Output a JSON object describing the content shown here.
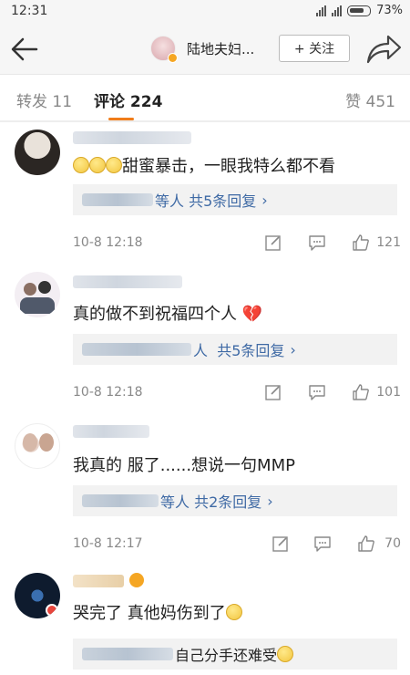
{
  "status": {
    "time": "12:31",
    "battery": "73%"
  },
  "header": {
    "account_name": "陆地夫妇...",
    "follow_label": "+ 关注"
  },
  "tabs": {
    "repost": "转发 11",
    "comments": "评论 224",
    "likes": "赞 451"
  },
  "comments": [
    {
      "text": "甜蜜暴击，一眼我特么都不看",
      "reply_suffix": "等人",
      "reply_count": "共5条回复",
      "time": "10-8 12:18",
      "likes": "121"
    },
    {
      "text": "真的做不到祝福四个人",
      "reply_suffix": "人",
      "reply_count": "共5条回复",
      "time": "10-8 12:18",
      "likes": "101"
    },
    {
      "text": "我真的 服了......想说一句MMP",
      "reply_suffix": "等人",
      "reply_count": "共2条回复",
      "time": "10-8 12:17",
      "likes": "70"
    },
    {
      "text": "哭完了 真他妈伤到了",
      "reply_preview": "自己分手还难受"
    }
  ],
  "colors": {
    "accent": "#f07c1a",
    "link": "#3f6aa5"
  }
}
